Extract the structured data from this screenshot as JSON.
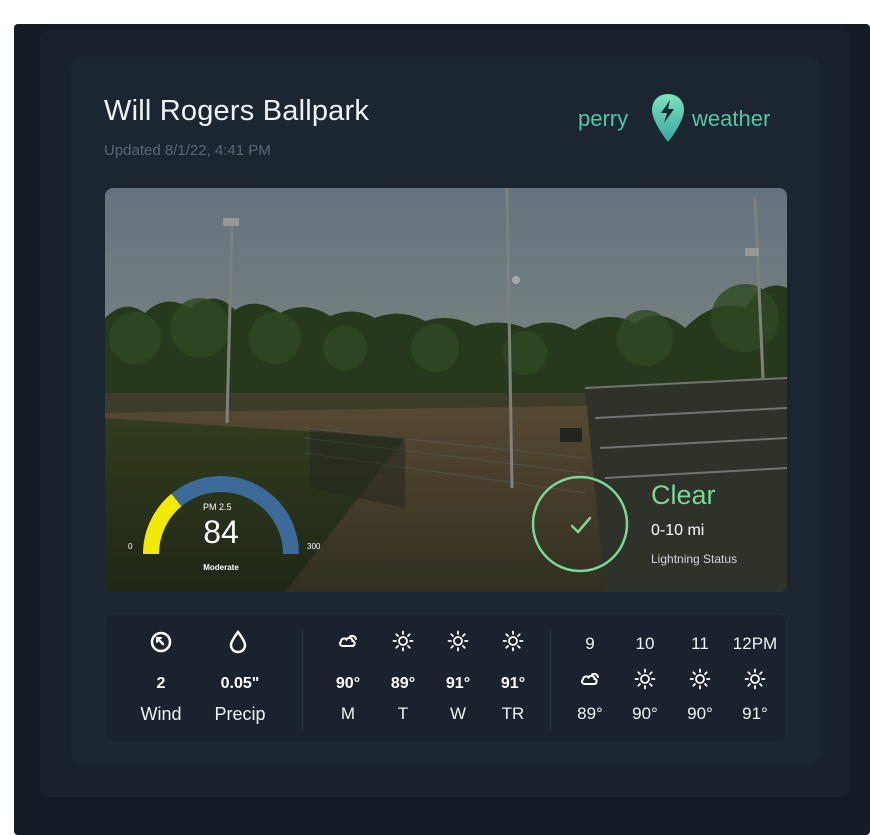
{
  "card": {
    "title": "Will Rogers Ballpark",
    "updated": "Updated 8/1/22, 4:41 PM"
  },
  "logo": {
    "word_left": "perry",
    "word_right": "weather",
    "icon": "lightning-pin-icon"
  },
  "air_quality": {
    "metric": "PM 2.5",
    "value": "84",
    "level": "Moderate",
    "min_label": "0",
    "max_label": "300",
    "fraction": 0.28,
    "colors": {
      "fill": "#f1e900",
      "track": "#3e6a99"
    }
  },
  "lightning": {
    "status": "Clear",
    "range": "0-10 mi",
    "label": "Lightning Status",
    "icon": "check-circle-icon",
    "color": "#7cd69a"
  },
  "current": {
    "wind": {
      "value": "2",
      "label": "Wind",
      "icon": "compass-icon"
    },
    "precip": {
      "value": "0.05\"",
      "label": "Precip",
      "icon": "droplet-icon"
    }
  },
  "daily": [
    {
      "icon": "partly-cloudy-icon",
      "temp": "90°",
      "day": "M"
    },
    {
      "icon": "sun-icon",
      "temp": "89°",
      "day": "T"
    },
    {
      "icon": "sun-icon",
      "temp": "91°",
      "day": "W"
    },
    {
      "icon": "sun-icon",
      "temp": "91°",
      "day": "TR"
    }
  ],
  "hourly": [
    {
      "hour": "9",
      "icon": "partly-cloudy-icon",
      "temp": "89°"
    },
    {
      "hour": "10",
      "icon": "sun-icon",
      "temp": "90°"
    },
    {
      "hour": "11",
      "icon": "sun-icon",
      "temp": "90°"
    },
    {
      "hour": "12PM",
      "icon": "sun-icon",
      "temp": "91°"
    }
  ],
  "colors": {
    "accent": "#55c6a4",
    "background": "#1c2631"
  }
}
